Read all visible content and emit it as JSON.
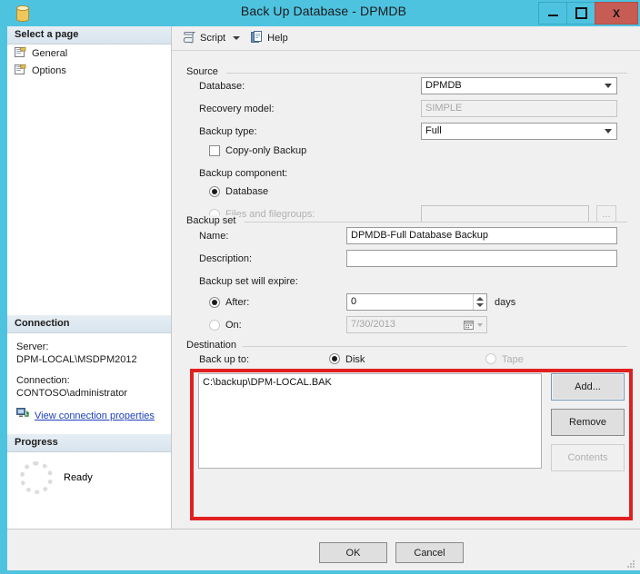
{
  "window": {
    "title": "Back Up Database - DPMDB",
    "icon": "database-cylinder-icon",
    "minimize_label": "Minimize",
    "maximize_label": "Maximize",
    "close_label": "X"
  },
  "toolbar": {
    "script_label": "Script",
    "script_icon": "script-icon",
    "dropdown_label": "",
    "help_label": "Help",
    "help_icon": "help-page-icon"
  },
  "sidebar": {
    "select_page_header": "Select a page",
    "pages": [
      {
        "label": "General",
        "icon": "page-icon"
      },
      {
        "label": "Options",
        "icon": "page-icon"
      }
    ],
    "connection_header": "Connection",
    "server_label": "Server:",
    "server_value": "DPM-LOCAL\\MSDPM2012",
    "connection_label": "Connection:",
    "connection_value": "CONTOSO\\administrator",
    "view_properties_link": "View connection properties",
    "view_properties_icon": "connection-properties-icon",
    "progress_header": "Progress",
    "progress_status": "Ready",
    "progress_icon": "spinner-icon"
  },
  "source": {
    "legend": "Source",
    "database_label": "Database:",
    "database_value": "DPMDB",
    "recovery_model_label": "Recovery model:",
    "recovery_model_value": "SIMPLE",
    "backup_type_label": "Backup type:",
    "backup_type_value": "Full",
    "copy_only_label": "Copy-only Backup",
    "copy_only_checked": false,
    "backup_component_label": "Backup component:",
    "component_database_label": "Database",
    "component_files_label": "Files and filegroups:",
    "component_files_value": "",
    "files_browse_label": "...",
    "selected_component": "Database"
  },
  "backup_set": {
    "legend": "Backup set",
    "name_label": "Name:",
    "name_value": "DPMDB-Full Database Backup",
    "description_label": "Description:",
    "description_value": "",
    "expire_label": "Backup set will expire:",
    "after_label": "After:",
    "after_value": "0",
    "days_label": "days",
    "on_label": "On:",
    "on_value": "7/30/2013",
    "selected_expire": "After"
  },
  "destination": {
    "legend": "Destination",
    "backup_to_label": "Back up to:",
    "disk_label": "Disk",
    "tape_label": "Tape",
    "selected_media": "Disk",
    "paths": [
      "C:\\backup\\DPM-LOCAL.BAK"
    ],
    "add_button": "Add...",
    "remove_button": "Remove",
    "contents_button": "Contents",
    "highlight_color": "#e02020"
  },
  "footer": {
    "ok_label": "OK",
    "cancel_label": "Cancel"
  }
}
